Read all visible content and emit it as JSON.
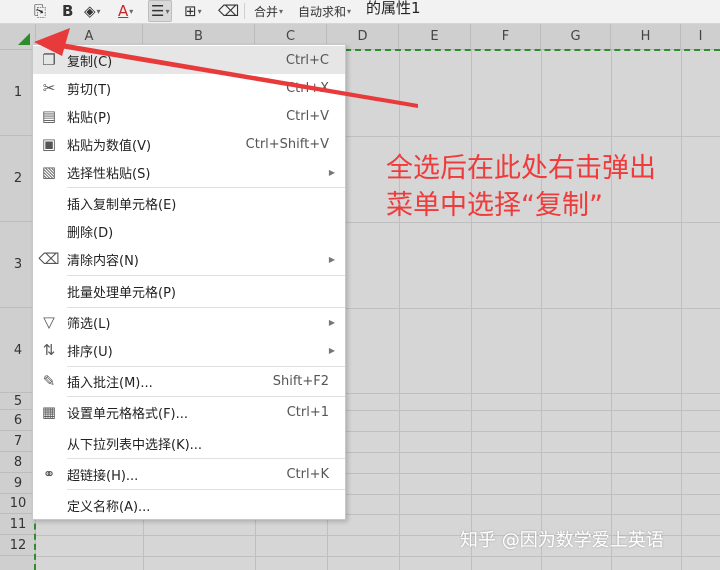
{
  "toolbar": {
    "bold_label": "B",
    "font_color_label": "A",
    "merge_label": "合并",
    "autosum_label": "自动求和",
    "truncated_text": "的属性1"
  },
  "columns": [
    "A",
    "B",
    "C",
    "D",
    "E",
    "F",
    "G",
    "H",
    "I"
  ],
  "rows": [
    "1",
    "2",
    "3",
    "4",
    "5",
    "6",
    "7",
    "8",
    "9",
    "10",
    "11",
    "12"
  ],
  "context_menu": {
    "items": [
      {
        "label": "复制(C)",
        "shortcut": "Ctrl+C",
        "icon": "copy-icon"
      },
      {
        "label": "剪切(T)",
        "shortcut": "Ctrl+X",
        "icon": "scissors-icon"
      },
      {
        "label": "粘贴(P)",
        "shortcut": "Ctrl+V",
        "icon": "paste-icon"
      },
      {
        "label": "粘贴为数值(V)",
        "shortcut": "Ctrl+Shift+V",
        "icon": "paste-values-icon"
      },
      {
        "label": "选择性粘贴(S)",
        "shortcut": "",
        "icon": "paste-special-icon"
      },
      {
        "label": "插入复制单元格(E)",
        "shortcut": "",
        "icon": ""
      },
      {
        "label": "删除(D)",
        "shortcut": "",
        "icon": ""
      },
      {
        "label": "清除内容(N)",
        "shortcut": "",
        "icon": "eraser-icon"
      },
      {
        "label": "批量处理单元格(P)",
        "shortcut": "",
        "icon": ""
      },
      {
        "label": "筛选(L)",
        "shortcut": "",
        "icon": "filter-icon"
      },
      {
        "label": "排序(U)",
        "shortcut": "",
        "icon": "sort-icon"
      },
      {
        "label": "插入批注(M)...",
        "shortcut": "Shift+F2",
        "icon": "comment-icon"
      },
      {
        "label": "设置单元格格式(F)...",
        "shortcut": "Ctrl+1",
        "icon": "format-cells-icon"
      },
      {
        "label": "从下拉列表中选择(K)...",
        "shortcut": "",
        "icon": ""
      },
      {
        "label": "超链接(H)...",
        "shortcut": "Ctrl+K",
        "icon": "link-icon"
      },
      {
        "label": "定义名称(A)...",
        "shortcut": "",
        "icon": ""
      }
    ]
  },
  "annotation": {
    "line1": "全选后在此处右击弹出",
    "line2": "菜单中选择“复制”",
    "color": "#ee3b3b"
  },
  "watermark": "知乎 @因为数学爱上英语",
  "colors": {
    "selection_green": "#2e8b2e",
    "arrow_red": "#e83a3a"
  }
}
